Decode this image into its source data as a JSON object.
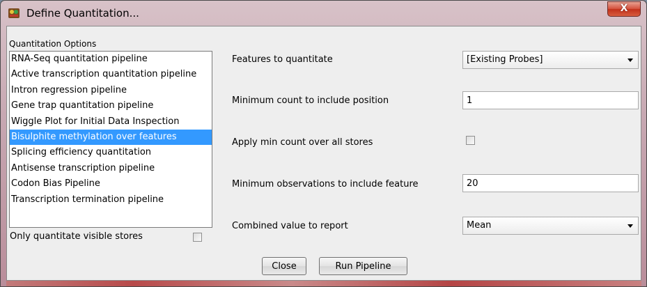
{
  "window": {
    "title": "Define Quantitation...",
    "close_glyph": "X"
  },
  "options": {
    "label": "Quantitation Options",
    "items": [
      "RNA-Seq quantitation pipeline",
      "Active transcription quantitation pipeline",
      "Intron regression pipeline",
      "Gene trap quantitation pipeline",
      "Wiggle Plot for Initial Data Inspection",
      "Bisulphite methylation over features",
      "Splicing efficiency quantitation",
      "Antisense transcription pipeline",
      "Codon Bias Pipeline",
      "Transcription termination pipeline"
    ],
    "selected_index": 5,
    "only_visible_label": "Only quantitate visible stores",
    "only_visible_checked": false
  },
  "form": {
    "features_label": "Features to quantitate",
    "features_value": "[Existing Probes]",
    "min_count_label": "Minimum count to include position",
    "min_count_value": "1",
    "apply_min_label": "Apply min count over all stores",
    "apply_min_checked": false,
    "min_obs_label": "Minimum observations to include feature",
    "min_obs_value": "20",
    "combined_label": "Combined value to report",
    "combined_value": "Mean"
  },
  "buttons": {
    "close": "Close",
    "run": "Run Pipeline"
  },
  "colors": {
    "selection": "#3399ff",
    "close_button": "#c7432b"
  }
}
